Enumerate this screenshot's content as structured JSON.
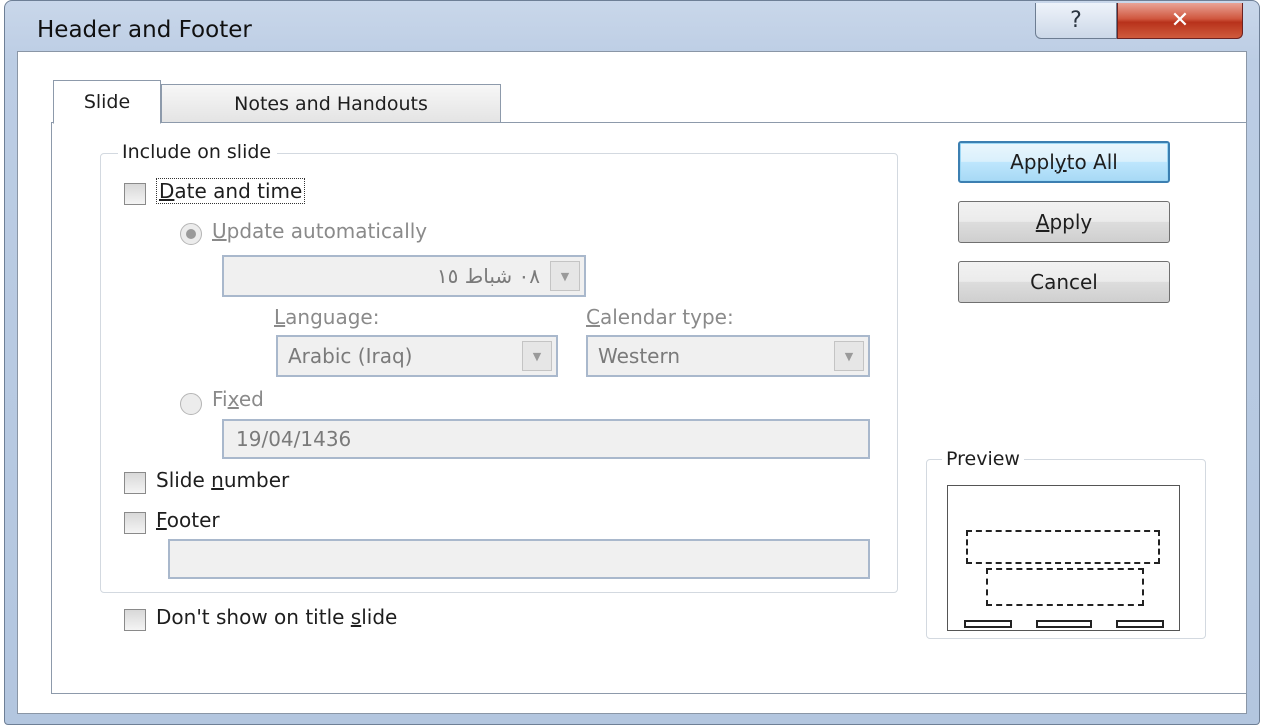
{
  "window": {
    "title": "Header and Footer",
    "help_glyph": "?",
    "close_glyph": "✕"
  },
  "tabs": [
    {
      "label": "Slide",
      "selected": true
    },
    {
      "label": "Notes and Handouts",
      "selected": false
    }
  ],
  "group": {
    "label": "Include on slide"
  },
  "date_time": {
    "checked": false,
    "label_mnemonic": "D",
    "label_rest": "ate and time",
    "update_auto": {
      "selected": true,
      "label_mnemonic": "U",
      "label_rest": "pdate automatically",
      "value": "٠٨ شباط ١٥"
    },
    "language": {
      "label_mnemonic": "L",
      "label_rest": "anguage:",
      "value": "Arabic (Iraq)"
    },
    "calendar": {
      "label_mnemonic": "C",
      "label_rest": "alendar type:",
      "value": "Western"
    },
    "fixed": {
      "selected": false,
      "label_pre": "Fi",
      "label_mnemonic": "x",
      "label_post": "ed",
      "value": "19/04/1436"
    }
  },
  "slide_number": {
    "checked": false,
    "label_pre": "Slide ",
    "label_mnemonic": "n",
    "label_post": "umber"
  },
  "footer": {
    "checked": false,
    "label_mnemonic": "F",
    "label_rest": "ooter",
    "value": ""
  },
  "dont_show_title": {
    "checked": false,
    "label_pre": "Don't show on title ",
    "label_mnemonic": "s",
    "label_post": "lide"
  },
  "buttons": {
    "apply_all_pre": "Appl",
    "apply_all_mnemonic": "y",
    "apply_all_post": " to All",
    "apply_mnemonic": "A",
    "apply_rest": "pply",
    "cancel": "Cancel"
  },
  "preview": {
    "label": "Preview"
  }
}
